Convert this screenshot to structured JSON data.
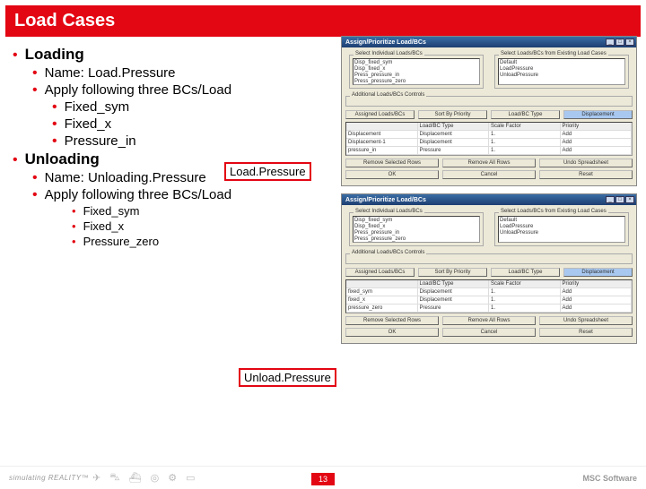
{
  "title": "Load Cases",
  "bullets": {
    "loading": {
      "label": "Loading",
      "name": "Name: Load.Pressure",
      "apply": "Apply following three BCs/Load",
      "bc1": "Fixed_sym",
      "bc2": "Fixed_x",
      "bc3": "Pressure_in"
    },
    "unloading": {
      "label": "Unloading",
      "name": "Name: Unloading.Pressure",
      "apply": "Apply following three BCs/Load",
      "bc1": "Fixed_sym",
      "bc2": "Fixed_x",
      "bc3": "Pressure_zero"
    }
  },
  "callouts": {
    "c1": "Load.Pressure",
    "c2": "Unload.Pressure"
  },
  "win1": {
    "title": "Assign/Prioritize Load/BCs",
    "left_label": "Select Individual Loads/BCs",
    "right_label": "Select Loads/BCs from Existing Load Cases",
    "left_items": [
      "Disp_fixed_sym",
      "Disp_fixed_x",
      "Press_pressure_in",
      "Press_pressure_zero"
    ],
    "right_items": [
      "Default",
      "LoadPressure",
      "UnloadPressure"
    ],
    "controls": "Additional Loads/BCs Controls",
    "btns": [
      "Assigned Loads/BCs",
      "Sort By Priority",
      "Load/BC Type"
    ],
    "combo": "Displacement",
    "table_head": [
      "",
      "Load/BC Type",
      "Scale Factor",
      "Priority"
    ],
    "rows": [
      [
        "Displacement",
        "Displacement",
        "1.",
        "Add"
      ],
      [
        "Displacement-1",
        "Displacement",
        "1.",
        "Add"
      ],
      [
        "pressure_in",
        "Pressure",
        "1.",
        "Add"
      ]
    ],
    "bot_btns": [
      "Remove Selected Rows",
      "Remove All Rows",
      "Undo Spreadsheet"
    ],
    "final_btns": [
      "OK",
      "Cancel",
      "Reset"
    ]
  },
  "win2": {
    "title": "Assign/Prioritize Load/BCs",
    "left_label": "Select Individual Loads/BCs",
    "right_label": "Select Loads/BCs from Existing Load Cases",
    "left_items": [
      "Disp_fixed_sym",
      "Disp_fixed_x",
      "Press_pressure_in",
      "Press_pressure_zero"
    ],
    "right_items": [
      "Default",
      "LoadPressure",
      "UnloadPressure"
    ],
    "controls": "Additional Loads/BCs Controls",
    "btns": [
      "Assigned Loads/BCs",
      "Sort By Priority",
      "Load/BC Type"
    ],
    "combo": "Displacement",
    "table_head": [
      "",
      "Load/BC Type",
      "Scale Factor",
      "Priority"
    ],
    "rows": [
      [
        "fixed_sym",
        "Displacement",
        "1.",
        "Add"
      ],
      [
        "fixed_x",
        "Displacement",
        "1.",
        "Add"
      ],
      [
        "pressure_zero",
        "Pressure",
        "1.",
        "Add"
      ]
    ],
    "bot_btns": [
      "Remove Selected Rows",
      "Remove All Rows",
      "Undo Spreadsheet"
    ],
    "final_btns": [
      "OK",
      "Cancel",
      "Reset"
    ]
  },
  "footer": {
    "brand": "simulating REALITY™",
    "page": "13",
    "logo": "MSC Software"
  }
}
